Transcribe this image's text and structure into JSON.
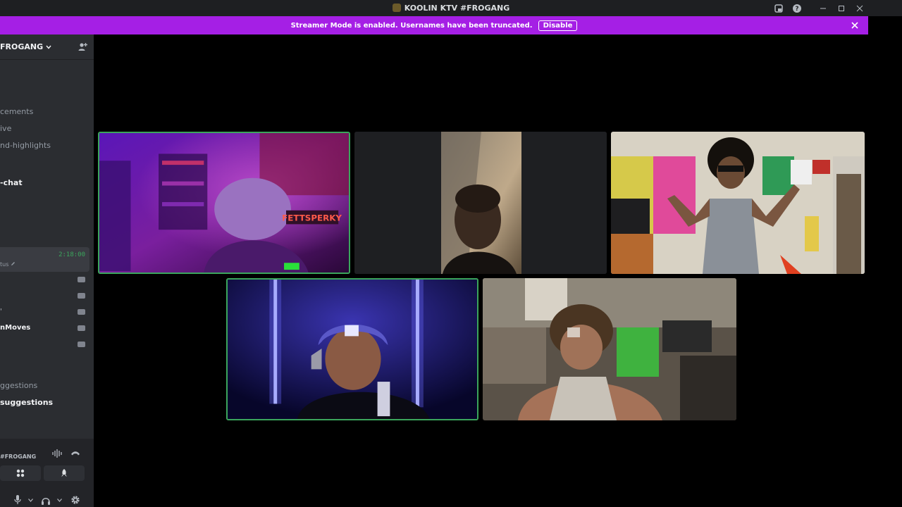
{
  "window": {
    "title": "KOOLIN KTV #FROGANG"
  },
  "banner": {
    "message": "Streamer Mode is enabled. Usernames have been truncated.",
    "disable_label": "Disable"
  },
  "server": {
    "name": "FROGANG"
  },
  "channels": [
    {
      "label": "cements"
    },
    {
      "label": "ive"
    },
    {
      "label": "nd-highlights"
    },
    {
      "label": "-chat"
    }
  ],
  "status": {
    "timer": "2:18:00",
    "sub": "tus"
  },
  "members": [
    {
      "label": ""
    },
    {
      "label": ""
    },
    {
      "label": "'"
    },
    {
      "label": "nMoves"
    },
    {
      "label": ""
    }
  ],
  "more_channels": [
    {
      "label": "ggestions"
    },
    {
      "label": "suggestions"
    }
  ],
  "voice": {
    "channel": "#FROGANG"
  },
  "icons": {
    "add_member": "add-member-icon",
    "soundboard": "waveform-icon",
    "disconnect": "phone-hangup-icon",
    "activities": "apps-icon",
    "stage": "rocket-icon",
    "mic": "microphone-icon",
    "headset": "headphones-icon",
    "settings": "gear-icon"
  },
  "colors": {
    "banner": "#a51fe5",
    "speaking": "#3ba55c",
    "sidebar": "#2b2d31"
  }
}
